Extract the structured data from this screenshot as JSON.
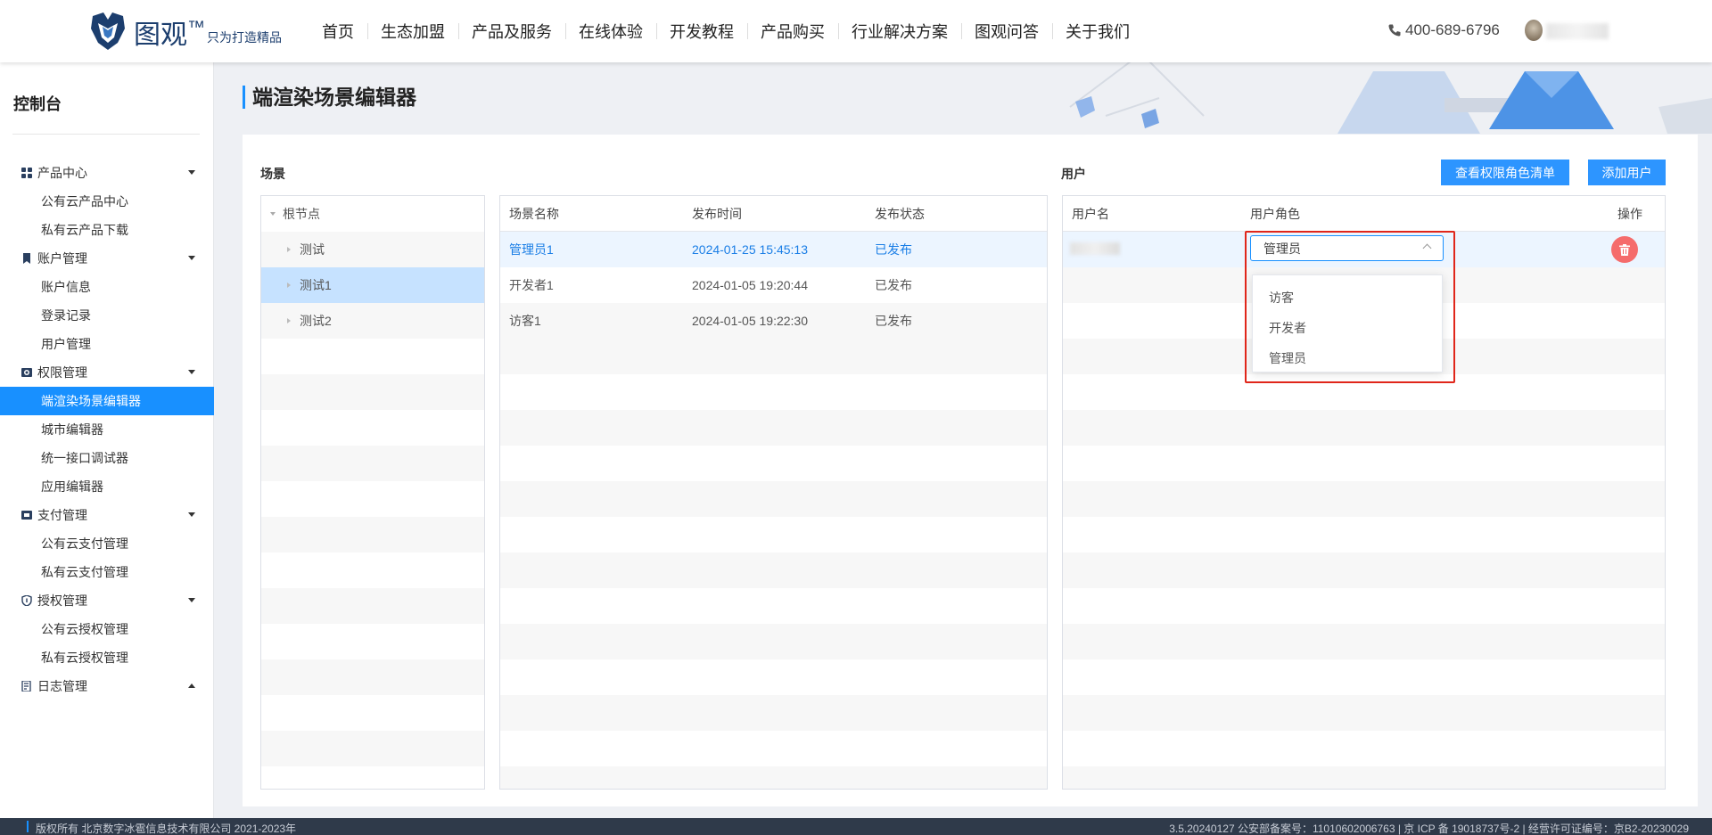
{
  "brand": {
    "name": "图观",
    "tm": "™",
    "slogan": "只为打造精品"
  },
  "nav": [
    "首页",
    "生态加盟",
    "产品及服务",
    "在线体验",
    "开发教程",
    "产品购买",
    "行业解决方案",
    "图观问答",
    "关于我们"
  ],
  "phone": "400-689-6796",
  "sidebar": {
    "title": "控制台",
    "groups": [
      {
        "label": "产品中心",
        "icon": "grid-icon",
        "items": [
          "公有云产品中心",
          "私有云产品下载"
        ]
      },
      {
        "label": "账户管理",
        "icon": "bookmark-icon",
        "items": [
          "账户信息",
          "登录记录",
          "用户管理"
        ]
      },
      {
        "label": "权限管理",
        "icon": "camera-icon",
        "items": [
          "端渲染场景编辑器",
          "城市编辑器",
          "统一接口调试器",
          "应用编辑器"
        ]
      },
      {
        "label": "支付管理",
        "icon": "payment-icon",
        "items": [
          "公有云支付管理",
          "私有云支付管理"
        ]
      },
      {
        "label": "授权管理",
        "icon": "shield-icon",
        "items": [
          "公有云授权管理",
          "私有云授权管理"
        ]
      },
      {
        "label": "日志管理",
        "icon": "log-icon",
        "items": []
      }
    ],
    "active_item": "端渲染场景编辑器"
  },
  "page": {
    "title": "端渲染场景编辑器"
  },
  "scene": {
    "label": "场景",
    "tree": {
      "root": "根节点",
      "children": [
        "测试",
        "测试1",
        "测试2"
      ],
      "selected": "测试1"
    },
    "table": {
      "headers": [
        "场景名称",
        "发布时间",
        "发布状态"
      ],
      "rows": [
        [
          "管理员1",
          "2024-01-25 15:45:13",
          "已发布"
        ],
        [
          "开发者1",
          "2024-01-05 19:20:44",
          "已发布"
        ],
        [
          "访客1",
          "2024-01-05 19:22:30",
          "已发布"
        ]
      ]
    }
  },
  "users": {
    "label": "用户",
    "buttons": {
      "view_roles": "查看权限角色清单",
      "add_user": "添加用户"
    },
    "headers": [
      "用户名",
      "用户角色",
      "操作"
    ],
    "role_select": {
      "value": "管理员",
      "options": [
        "访客",
        "开发者",
        "管理员"
      ]
    }
  },
  "footer": {
    "left": "版权所有 北京数字冰雹信息技术有限公司 2021-2023年",
    "right": "3.5.20240127 公安部备案号：11010602006763 | 京 ICP 备 19018737号-2 | 经营许可证编号：京B2-20230029"
  },
  "colors": {
    "accent": "#1890ff",
    "button": "#2d95ff",
    "danger": "#f56c6c",
    "frame": "#e0261a"
  }
}
